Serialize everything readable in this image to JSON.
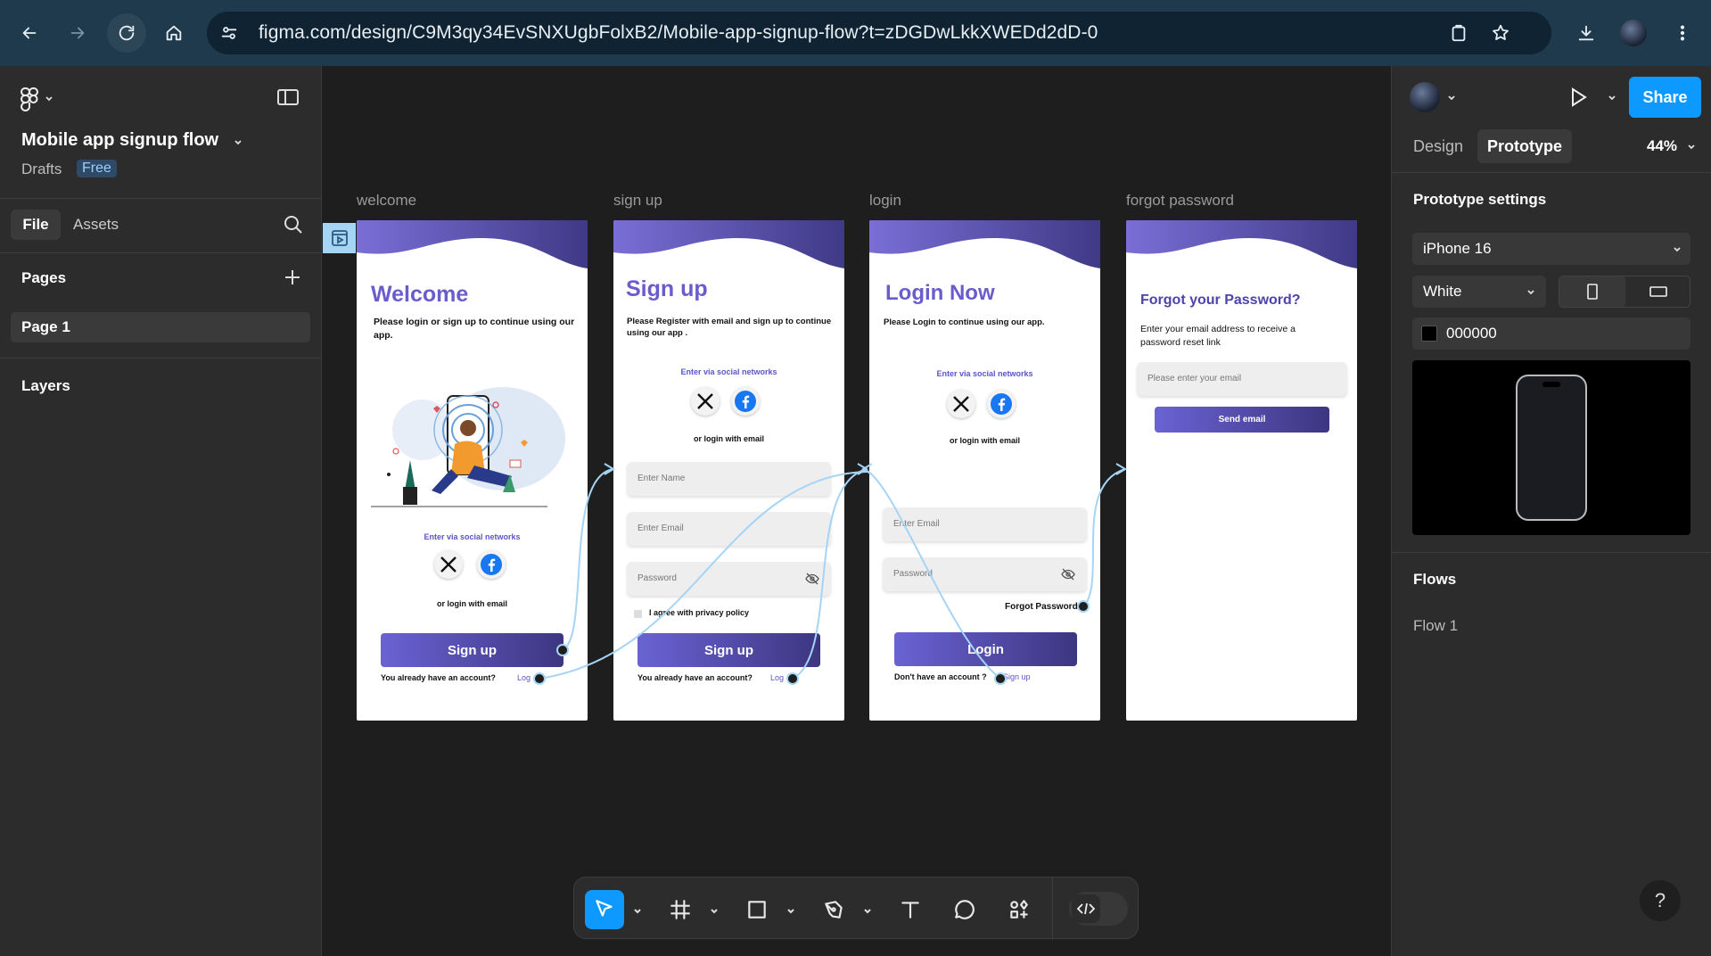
{
  "browser": {
    "url": "figma.com/design/C9M3qy34EvSNXUgbFolxB2/Mobile-app-signup-flow?t=zDGDwLkkXWEDd2dD-0"
  },
  "file": {
    "name": "Mobile app signup flow",
    "location": "Drafts",
    "plan_badge": "Free"
  },
  "left_panel": {
    "tabs": [
      "File",
      "Assets"
    ],
    "pages_heading": "Pages",
    "pages": [
      "Page 1"
    ],
    "layers_heading": "Layers"
  },
  "canvas": {
    "frames": [
      {
        "label": "welcome",
        "title": "Welcome",
        "subtitle": "Please login or sign up to continue using our app.",
        "social_label": "Enter via social networks",
        "email_label": "or login with email",
        "button": "Sign up",
        "footer_text": "You already have an account?",
        "footer_link": "Log"
      },
      {
        "label": "sign up",
        "title": "Sign up",
        "subtitle": "Please Register with email and sign up to continue using our app .",
        "social_label": "Enter via social networks",
        "email_label": "or login with email",
        "fields": [
          "Enter Name",
          "Enter Email",
          "Password"
        ],
        "checkbox_label": "I agree with privacy policy",
        "button": "Sign up",
        "footer_text": "You already have an account?",
        "footer_link": "Log"
      },
      {
        "label": "login",
        "title": "Login Now",
        "subtitle": "Please Login to continue using our app.",
        "social_label": "Enter via social networks",
        "email_label": "or login with email",
        "fields": [
          "Enter Email",
          "Password"
        ],
        "forgot": "Forgot Password",
        "button": "Login",
        "footer_text": "Don't have an account ?",
        "footer_link": "Sign up"
      },
      {
        "label": "forgot password",
        "title": "Forgot your Password?",
        "subtitle": "Enter your email address to receive a password reset link",
        "field": "Please enter your email",
        "button": "Send email"
      }
    ]
  },
  "right_panel": {
    "share_label": "Share",
    "tabs": [
      "Design",
      "Prototype"
    ],
    "active_tab": "Prototype",
    "zoom": "44%",
    "settings_heading": "Prototype settings",
    "device": "iPhone 16",
    "device_color": "White",
    "background_hex": "000000",
    "flows_heading": "Flows",
    "flows": [
      "Flow 1"
    ]
  },
  "help_label": "?",
  "colors": {
    "accent": "#0d99ff",
    "brand_purple": "#6a5ccd",
    "connector": "#a6d4f5",
    "chrome": "#1f3a4d"
  },
  "icons": [
    "back-arrow-icon",
    "forward-arrow-icon",
    "reload-icon",
    "home-icon",
    "site-settings-icon",
    "clipboard-icon",
    "star-icon",
    "download-icon",
    "kebab-menu-icon",
    "figma-logo-icon",
    "sidebar-toggle-icon",
    "search-icon",
    "plus-icon",
    "play-icon",
    "move-tool-icon",
    "frame-tool-icon",
    "rectangle-tool-icon",
    "pen-tool-icon",
    "text-tool-icon",
    "comment-tool-icon",
    "components-icon",
    "dev-mode-icon"
  ]
}
